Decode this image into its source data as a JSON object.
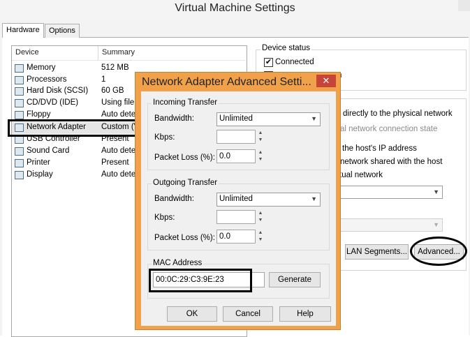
{
  "window": {
    "title": "Virtual Machine Settings"
  },
  "tabs": [
    "Hardware",
    "Options"
  ],
  "device_list": {
    "headers": {
      "device": "Device",
      "summary": "Summary"
    },
    "rows": [
      {
        "name": "Memory",
        "summary": "512 MB",
        "icon": "memory-icon"
      },
      {
        "name": "Processors",
        "summary": "1",
        "icon": "processor-icon"
      },
      {
        "name": "Hard Disk (SCSI)",
        "summary": "60 GB",
        "icon": "hard-disk-icon"
      },
      {
        "name": "CD/DVD (IDE)",
        "summary": "Using file C",
        "icon": "cd-dvd-icon"
      },
      {
        "name": "Floppy",
        "summary": "Auto detect",
        "icon": "floppy-icon"
      },
      {
        "name": "Network Adapter",
        "summary": "Custom (V",
        "icon": "network-adapter-icon"
      },
      {
        "name": "USB Controller",
        "summary": "Present",
        "icon": "usb-icon"
      },
      {
        "name": "Sound Card",
        "summary": "Auto detect",
        "icon": "sound-card-icon"
      },
      {
        "name": "Printer",
        "summary": "Present",
        "icon": "printer-icon"
      },
      {
        "name": "Display",
        "summary": "Auto detect",
        "icon": "display-icon"
      }
    ]
  },
  "device_status": {
    "legend": "Device status",
    "connected": "Connected",
    "connected_checked": true,
    "connect_at_power_on_fragment": "n"
  },
  "network_connection": {
    "bridged_text": "directly to the physical network",
    "replicate_text": "al network connection state",
    "nat_text": "the host's IP address",
    "hostonly_text": "network shared with the host",
    "custom_text": "tual network",
    "lan_segments_button": "LAN Segments...",
    "advanced_button": "Advanced..."
  },
  "dialog": {
    "title": "Network Adapter Advanced Setti...",
    "close_glyph": "✕",
    "incoming": {
      "legend": "Incoming Transfer",
      "bandwidth_label": "Bandwidth:",
      "bandwidth_value": "Unlimited",
      "kbps_label": "Kbps:",
      "kbps_value": "",
      "loss_label": "Packet Loss (%):",
      "loss_value": "0.0"
    },
    "outgoing": {
      "legend": "Outgoing Transfer",
      "bandwidth_label": "Bandwidth:",
      "bandwidth_value": "Unlimited",
      "kbps_label": "Kbps:",
      "kbps_value": "",
      "loss_label": "Packet Loss (%):",
      "loss_value": "0.0"
    },
    "mac": {
      "legend": "MAC Address",
      "value": "00:0C:29:C3:9E:23",
      "generate_button": "Generate"
    },
    "buttons": {
      "ok": "OK",
      "cancel": "Cancel",
      "help": "Help"
    }
  },
  "colors": {
    "dialog_frame": "#f2a14b",
    "close_button": "#c7443a"
  }
}
